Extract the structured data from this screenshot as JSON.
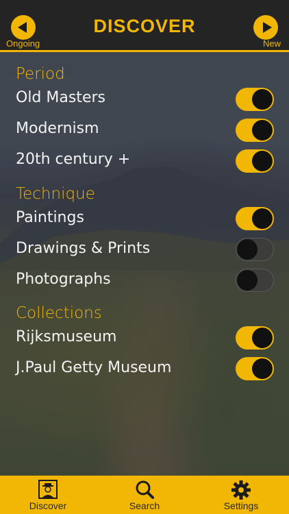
{
  "header": {
    "title": "DISCOVER",
    "left_label": "Ongoing",
    "right_label": "New"
  },
  "sections": [
    {
      "title": "Period",
      "items": [
        {
          "label": "Old Masters",
          "on": true
        },
        {
          "label": "Modernism",
          "on": true
        },
        {
          "label": "20th century +",
          "on": true
        }
      ]
    },
    {
      "title": "Technique",
      "items": [
        {
          "label": "Paintings",
          "on": true
        },
        {
          "label": "Drawings & Prints",
          "on": false
        },
        {
          "label": "Photographs",
          "on": false
        }
      ]
    },
    {
      "title": "Collections",
      "items": [
        {
          "label": "Rijksmuseum",
          "on": true
        },
        {
          "label": "J.Paul Getty Museum",
          "on": true
        }
      ]
    }
  ],
  "tabs": [
    {
      "label": "Discover",
      "icon": "portrait-icon",
      "active": true
    },
    {
      "label": "Search",
      "icon": "search-icon",
      "active": false
    },
    {
      "label": "Settings",
      "icon": "gear-icon",
      "active": false
    }
  ],
  "colors": {
    "accent": "#f2b705",
    "bar": "#242424"
  }
}
